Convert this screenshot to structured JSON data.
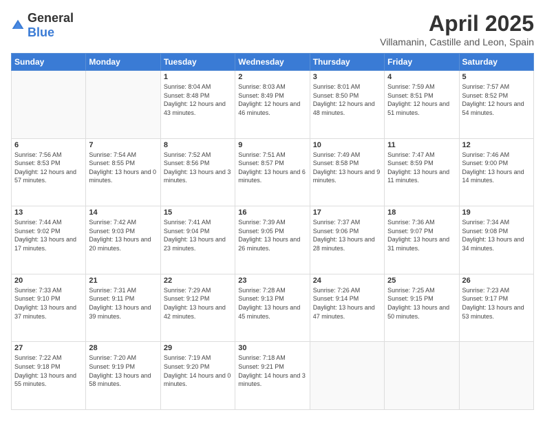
{
  "header": {
    "logo_general": "General",
    "logo_blue": "Blue",
    "title": "April 2025",
    "subtitle": "Villamanin, Castille and Leon, Spain"
  },
  "calendar": {
    "days_of_week": [
      "Sunday",
      "Monday",
      "Tuesday",
      "Wednesday",
      "Thursday",
      "Friday",
      "Saturday"
    ],
    "weeks": [
      [
        {
          "day": "",
          "info": ""
        },
        {
          "day": "",
          "info": ""
        },
        {
          "day": "1",
          "info": "Sunrise: 8:04 AM\nSunset: 8:48 PM\nDaylight: 12 hours and 43 minutes."
        },
        {
          "day": "2",
          "info": "Sunrise: 8:03 AM\nSunset: 8:49 PM\nDaylight: 12 hours and 46 minutes."
        },
        {
          "day": "3",
          "info": "Sunrise: 8:01 AM\nSunset: 8:50 PM\nDaylight: 12 hours and 48 minutes."
        },
        {
          "day": "4",
          "info": "Sunrise: 7:59 AM\nSunset: 8:51 PM\nDaylight: 12 hours and 51 minutes."
        },
        {
          "day": "5",
          "info": "Sunrise: 7:57 AM\nSunset: 8:52 PM\nDaylight: 12 hours and 54 minutes."
        }
      ],
      [
        {
          "day": "6",
          "info": "Sunrise: 7:56 AM\nSunset: 8:53 PM\nDaylight: 12 hours and 57 minutes."
        },
        {
          "day": "7",
          "info": "Sunrise: 7:54 AM\nSunset: 8:55 PM\nDaylight: 13 hours and 0 minutes."
        },
        {
          "day": "8",
          "info": "Sunrise: 7:52 AM\nSunset: 8:56 PM\nDaylight: 13 hours and 3 minutes."
        },
        {
          "day": "9",
          "info": "Sunrise: 7:51 AM\nSunset: 8:57 PM\nDaylight: 13 hours and 6 minutes."
        },
        {
          "day": "10",
          "info": "Sunrise: 7:49 AM\nSunset: 8:58 PM\nDaylight: 13 hours and 9 minutes."
        },
        {
          "day": "11",
          "info": "Sunrise: 7:47 AM\nSunset: 8:59 PM\nDaylight: 13 hours and 11 minutes."
        },
        {
          "day": "12",
          "info": "Sunrise: 7:46 AM\nSunset: 9:00 PM\nDaylight: 13 hours and 14 minutes."
        }
      ],
      [
        {
          "day": "13",
          "info": "Sunrise: 7:44 AM\nSunset: 9:02 PM\nDaylight: 13 hours and 17 minutes."
        },
        {
          "day": "14",
          "info": "Sunrise: 7:42 AM\nSunset: 9:03 PM\nDaylight: 13 hours and 20 minutes."
        },
        {
          "day": "15",
          "info": "Sunrise: 7:41 AM\nSunset: 9:04 PM\nDaylight: 13 hours and 23 minutes."
        },
        {
          "day": "16",
          "info": "Sunrise: 7:39 AM\nSunset: 9:05 PM\nDaylight: 13 hours and 26 minutes."
        },
        {
          "day": "17",
          "info": "Sunrise: 7:37 AM\nSunset: 9:06 PM\nDaylight: 13 hours and 28 minutes."
        },
        {
          "day": "18",
          "info": "Sunrise: 7:36 AM\nSunset: 9:07 PM\nDaylight: 13 hours and 31 minutes."
        },
        {
          "day": "19",
          "info": "Sunrise: 7:34 AM\nSunset: 9:08 PM\nDaylight: 13 hours and 34 minutes."
        }
      ],
      [
        {
          "day": "20",
          "info": "Sunrise: 7:33 AM\nSunset: 9:10 PM\nDaylight: 13 hours and 37 minutes."
        },
        {
          "day": "21",
          "info": "Sunrise: 7:31 AM\nSunset: 9:11 PM\nDaylight: 13 hours and 39 minutes."
        },
        {
          "day": "22",
          "info": "Sunrise: 7:29 AM\nSunset: 9:12 PM\nDaylight: 13 hours and 42 minutes."
        },
        {
          "day": "23",
          "info": "Sunrise: 7:28 AM\nSunset: 9:13 PM\nDaylight: 13 hours and 45 minutes."
        },
        {
          "day": "24",
          "info": "Sunrise: 7:26 AM\nSunset: 9:14 PM\nDaylight: 13 hours and 47 minutes."
        },
        {
          "day": "25",
          "info": "Sunrise: 7:25 AM\nSunset: 9:15 PM\nDaylight: 13 hours and 50 minutes."
        },
        {
          "day": "26",
          "info": "Sunrise: 7:23 AM\nSunset: 9:17 PM\nDaylight: 13 hours and 53 minutes."
        }
      ],
      [
        {
          "day": "27",
          "info": "Sunrise: 7:22 AM\nSunset: 9:18 PM\nDaylight: 13 hours and 55 minutes."
        },
        {
          "day": "28",
          "info": "Sunrise: 7:20 AM\nSunset: 9:19 PM\nDaylight: 13 hours and 58 minutes."
        },
        {
          "day": "29",
          "info": "Sunrise: 7:19 AM\nSunset: 9:20 PM\nDaylight: 14 hours and 0 minutes."
        },
        {
          "day": "30",
          "info": "Sunrise: 7:18 AM\nSunset: 9:21 PM\nDaylight: 14 hours and 3 minutes."
        },
        {
          "day": "",
          "info": ""
        },
        {
          "day": "",
          "info": ""
        },
        {
          "day": "",
          "info": ""
        }
      ]
    ]
  }
}
